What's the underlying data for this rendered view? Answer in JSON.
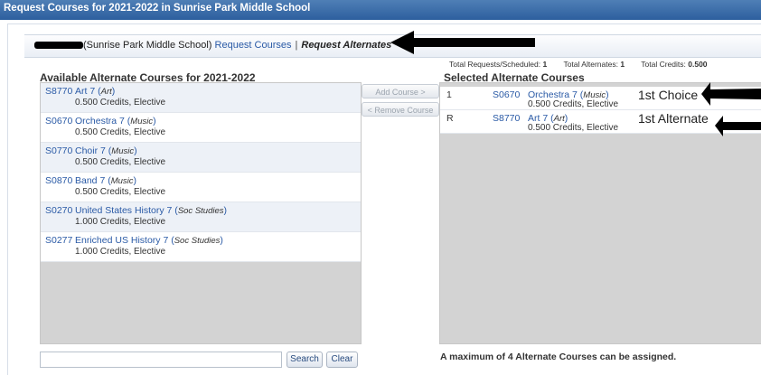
{
  "window": {
    "title": "Request Courses for 2021-2022 in Sunrise Park Middle School"
  },
  "breadcrumb": {
    "school_text": "(Sunrise Park Middle School)",
    "request_courses_link": "Request Courses",
    "separator": "|",
    "current": "Request Alternates"
  },
  "totals": {
    "requests_label": "Total Requests/Scheduled:",
    "requests_value": "1",
    "alternates_label": "Total Alternates:",
    "alternates_value": "1",
    "credits_label": "Total Credits:",
    "credits_value": "0.500"
  },
  "available": {
    "heading": "Available Alternate Courses for 2021-2022",
    "courses": [
      {
        "code": "S8770",
        "name": "Art 7",
        "dept": "Art",
        "details": "0.500 Credits,  Elective"
      },
      {
        "code": "S0670",
        "name": "Orchestra 7",
        "dept": "Music",
        "details": "0.500 Credits,  Elective"
      },
      {
        "code": "S0770",
        "name": "Choir 7",
        "dept": "Music",
        "details": "0.500 Credits,  Elective"
      },
      {
        "code": "S0870",
        "name": "Band 7",
        "dept": "Music",
        "details": "0.500 Credits,  Elective"
      },
      {
        "code": "S0270",
        "name": "United States History 7",
        "dept": "Soc Studies",
        "details": "1.000 Credits,  Elective"
      },
      {
        "code": "S0277",
        "name": "Enriched US History 7",
        "dept": "Soc Studies",
        "details": "1.000 Credits,  Elective"
      }
    ]
  },
  "actions": {
    "add_label": "Add Course >",
    "remove_label": "< Remove Course"
  },
  "selected": {
    "heading": "Selected Alternate Courses",
    "courses": [
      {
        "priority": "1",
        "code": "S0670",
        "name": "Orchestra 7",
        "dept": "Music",
        "details": "0.500 Credits,  Elective",
        "annotation": "1st Choice"
      },
      {
        "priority": "R",
        "code": "S8770",
        "name": "Art 7",
        "dept": "Art",
        "details": "0.500 Credits,  Elective",
        "annotation": "1st Alternate"
      }
    ]
  },
  "search": {
    "value": "",
    "button_label": "Search",
    "clear_label": "Clear"
  },
  "footer_note": "A maximum of 4 Alternate Courses can be assigned.",
  "colors": {
    "title_bar": "#2d5f9e",
    "link": "#2a5aa6",
    "panel_empty": "#d3d3d3",
    "row_alt": "#edf1f7"
  }
}
